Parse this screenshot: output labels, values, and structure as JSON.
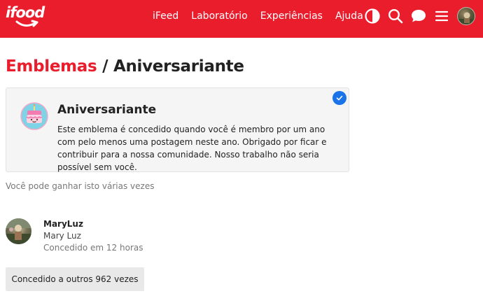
{
  "header": {
    "logo_text": "ifood",
    "nav": [
      "iFeed",
      "Laboratório",
      "Experiências",
      "Ajuda"
    ],
    "icons": [
      "theme-toggle-icon",
      "search-icon",
      "chat-icon",
      "menu-icon",
      "user-avatar"
    ],
    "brand_color": "#ea1d2c"
  },
  "breadcrumb": {
    "parent": "Emblemas",
    "separator": "/",
    "current": "Aniversariante"
  },
  "badge": {
    "name": "Aniversariante",
    "description": "Este emblema é concedido quando você é membro por um ano com pelo menos uma postagem neste ano. Obrigado por ficar e contribuir para a nossa comunidade. Nosso trabalho não seria possível sem você.",
    "granted_check_color": "#1a73e8"
  },
  "multiple_note": "Você pode ganhar isto várias vezes",
  "user": {
    "username": "MaryLuz",
    "full_name": "Mary Luz",
    "granted": "Concedido em 12 horas"
  },
  "others_button": "Concedido a outros 962 vezes"
}
